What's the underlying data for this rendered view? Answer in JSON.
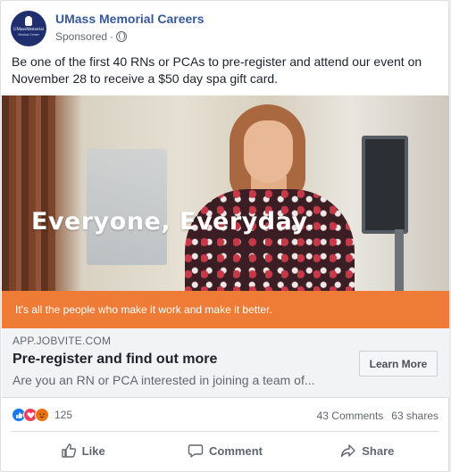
{
  "post": {
    "page_name": "UMass Memorial Careers",
    "sponsored": "Sponsored",
    "dot": "·",
    "text": "Be one of the first 40 RNs or PCAs to pre-register and attend our event on November 28 to receive a $50 day spa gift card.",
    "avatar_logo_text": "UMassMemorial",
    "avatar_logo_sub": "Medical Center"
  },
  "hero": {
    "headline": "Everyone, Everyday.",
    "banner_text": "It's all the people who make it work and make it better."
  },
  "link": {
    "domain": "APP.JOBVITE.COM",
    "title": "Pre-register and find out more",
    "description": "Are you an RN or PCA interested in joining a team of...",
    "cta_label": "Learn More"
  },
  "stats": {
    "reaction_count": "125",
    "comments": "43 Comments",
    "shares": "63 shares",
    "reactions": [
      "like-icon",
      "love-icon",
      "angry-icon"
    ]
  },
  "actions": {
    "like": "Like",
    "comment": "Comment",
    "share": "Share"
  },
  "colors": {
    "brand_link": "#385898",
    "banner": "#ee7b36",
    "like_blue": "#1877f2",
    "love_red": "#f33e58",
    "angry_orange": "#e9710f"
  }
}
